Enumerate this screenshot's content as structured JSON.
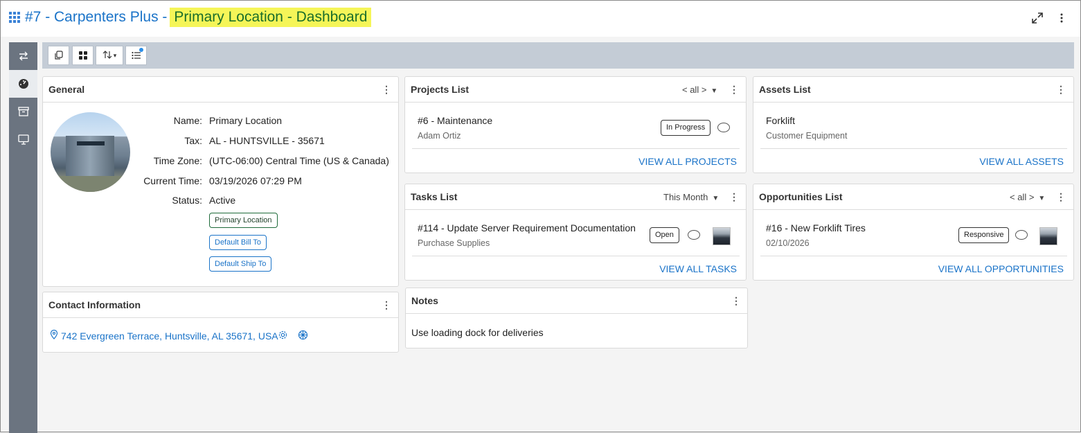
{
  "header": {
    "title_prefix": "#7 - Carpenters Plus -",
    "title_highlight": "Primary Location - Dashboard",
    "icons": [
      "grid-icon",
      "expand-icon",
      "more-vertical-icon"
    ]
  },
  "left_nav": {
    "items": [
      "swap-icon",
      "dashboard-gauge-icon",
      "archive-box-icon",
      "monitor-icon"
    ],
    "active_index": 1
  },
  "toolbar": {
    "buttons": [
      "copy-icon",
      "widgets-grid-icon",
      "sort-icon",
      "list-icon"
    ],
    "sort_caret": "▾"
  },
  "general": {
    "title": "General",
    "name_label": "Name:",
    "name_value": "Primary Location",
    "tax_label": "Tax:",
    "tax_value": "AL - HUNTSVILLE - 35671",
    "timezone_label": "Time Zone:",
    "timezone_value": "(UTC-06:00) Central Time (US & Canada)",
    "current_time_label": "Current Time:",
    "current_time_value": "03/19/2026 07:29 PM",
    "status_label": "Status:",
    "status_value": "Active",
    "tags": [
      "Primary Location",
      "Default Bill To",
      "Default Ship To"
    ]
  },
  "contact": {
    "title": "Contact Information",
    "address": "742 Evergreen Terrace, Huntsville, AL 35671, USA"
  },
  "projects": {
    "title": "Projects List",
    "filter": "< all >",
    "item_title": "#6 - Maintenance",
    "item_sub": "Adam Ortiz",
    "item_status": "In Progress",
    "view_all": "VIEW ALL PROJECTS"
  },
  "tasks": {
    "title": "Tasks List",
    "filter": "This Month",
    "item_title": "#114 - Update Server Requirement Documentation",
    "item_sub": "Purchase Supplies",
    "item_status": "Open",
    "view_all": "VIEW ALL TASKS"
  },
  "notes": {
    "title": "Notes",
    "text": "Use loading dock for deliveries"
  },
  "assets": {
    "title": "Assets List",
    "item_title": "Forklift",
    "item_sub": "Customer Equipment",
    "view_all": "VIEW ALL ASSETS"
  },
  "opportunities": {
    "title": "Opportunities List",
    "filter": "< all >",
    "item_title": "#16 - New Forklift Tires",
    "item_sub": "02/10/2026",
    "item_status": "Responsive",
    "view_all": "VIEW ALL OPPORTUNITIES"
  },
  "colors": {
    "accent": "#1a73c8",
    "highlight": "#f5f558",
    "green_tag": "#1e6b3a",
    "sidebar": "#6b7480",
    "toolbar": "#c4ccd6"
  }
}
